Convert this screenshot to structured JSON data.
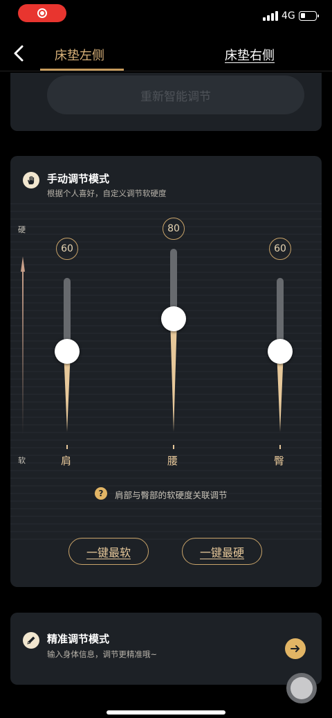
{
  "status": {
    "network": "4G"
  },
  "nav": {
    "tab_left": "床垫左侧",
    "tab_right": "床垫右侧"
  },
  "smart": {
    "button_label": "重新智能调节"
  },
  "manual": {
    "title": "手动调节模式",
    "subtitle": "根据个人喜好，自定义调节软硬度",
    "axis_hard": "硬",
    "axis_soft": "软",
    "sliders": [
      {
        "label": "肩",
        "value": "60",
        "level": 0.6
      },
      {
        "label": "腰",
        "value": "80",
        "level": 0.8
      },
      {
        "label": "臀",
        "value": "60",
        "level": 0.6
      }
    ],
    "link_note": "肩部与臀部的软硬度关联调节",
    "help_glyph": "?",
    "btn_softest": "一键最软",
    "btn_hardest": "一键最硬"
  },
  "precise": {
    "title": "精准调节模式",
    "subtitle": "输入身体信息，调节更精准哦~"
  },
  "colors": {
    "accent": "#c9a46a",
    "card": "#1d2126",
    "record": "#e8352f"
  }
}
